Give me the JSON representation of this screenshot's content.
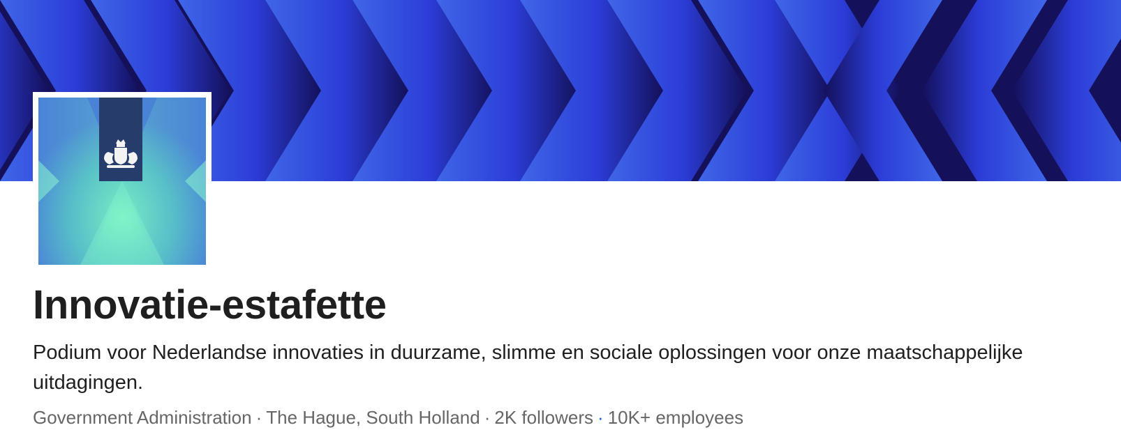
{
  "company": {
    "name": "Innovatie-estafette",
    "tagline": "Podium voor Nederlandse innovaties in duurzame, slimme en sociale oplossingen voor onze maatschappelijke uitdagingen.",
    "industry": "Government Administration",
    "location": "The Hague, South Holland",
    "followers": "2K followers",
    "employees": "10K+ employees",
    "meta_separator": "·"
  },
  "cover": {
    "description_icon": "chevron-pattern-banner",
    "colors": {
      "dark": "#14105a",
      "mid": "#2a3ad8",
      "light": "#3f64e6"
    }
  },
  "logo": {
    "icon": "royal-coat-of-arms-icon",
    "colors": {
      "band": "#263d6b",
      "mint": "#7bf0c2",
      "teal": "#4cb6c9",
      "blue": "#4a7ed6"
    }
  }
}
